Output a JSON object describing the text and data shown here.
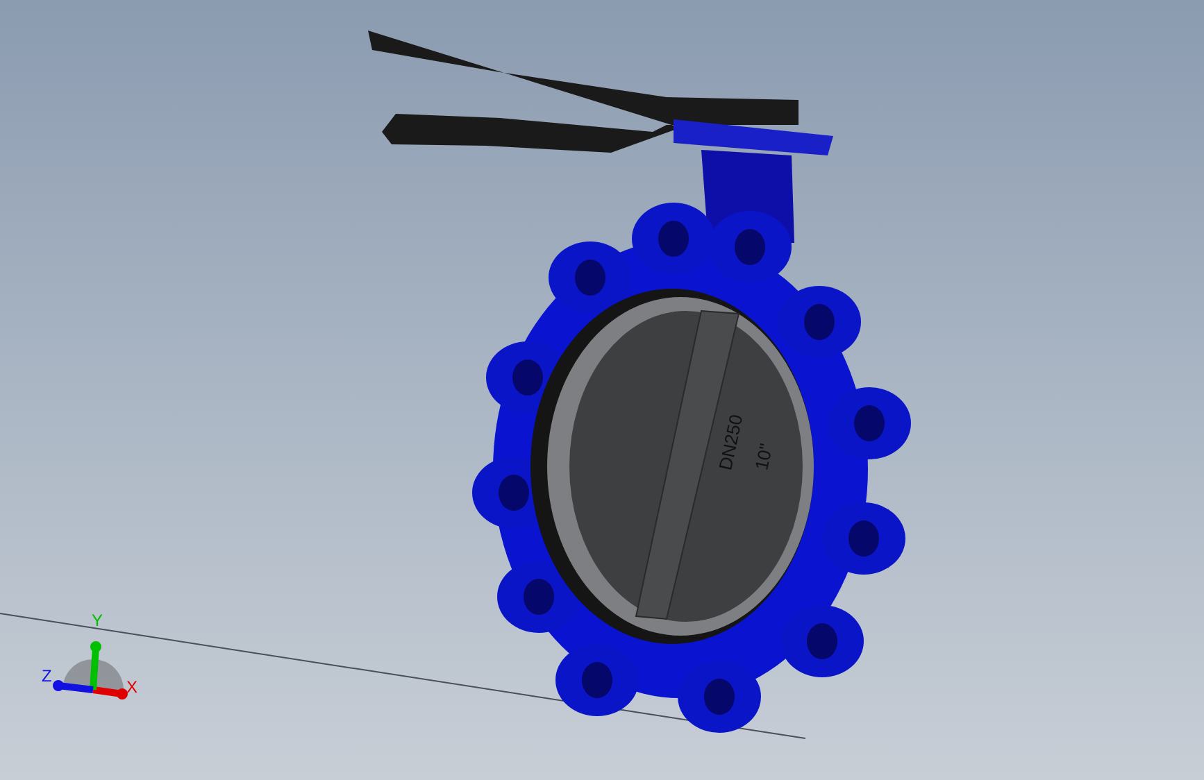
{
  "viewport": {
    "model": {
      "markings": [
        "DN250",
        "10\""
      ]
    },
    "triad": {
      "axes": [
        {
          "label": "X",
          "color": "#e00000"
        },
        {
          "label": "Y",
          "color": "#00c000"
        },
        {
          "label": "Z",
          "color": "#1010e0"
        }
      ]
    }
  }
}
